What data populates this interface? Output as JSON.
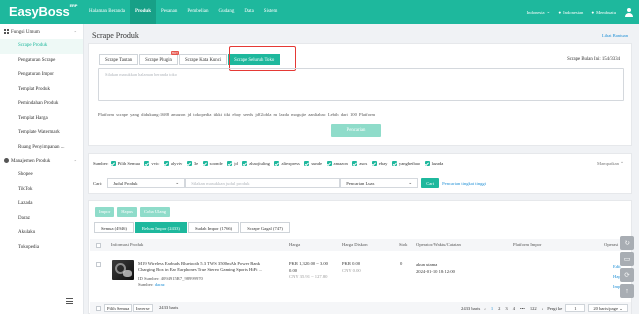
{
  "header": {
    "logo": "EasyBoss",
    "logo_sup": "ERP",
    "nav": [
      "Halaman Beranda",
      "Produk",
      "Pesanan",
      "Pembelian",
      "Gudang",
      "Data",
      "Sistem"
    ],
    "active_nav": "Produk",
    "region": "Indonesia",
    "lang": "Indonesian",
    "member": "Membuatu"
  },
  "sidebar": {
    "group1": "Fungsi Umum",
    "items1": [
      "Scrape Produk",
      "Pengaturan Scrape",
      "Pengaturan Impor",
      "Templat Produk",
      "Pemindahan Produk",
      "Templat Harga",
      "Template Watermark",
      "Ruang Penyimpanan ..."
    ],
    "active_item": "Scrape Produk",
    "group2": "Manajemen Produk",
    "items2": [
      "Shopee",
      "TikTok",
      "Lazada",
      "Daraz",
      "Akulaku",
      "Tokopedia"
    ]
  },
  "page": {
    "title": "Scrape Produk",
    "help": "Lihat Bantuan"
  },
  "scrape": {
    "tabs": [
      "Scrape Tautan",
      "Scrape Plugin",
      "Scrape Kata Kunci",
      "Scrape Seluruh Toko"
    ],
    "hot_badge": "HOT",
    "quota_label": "Scrape Bulan Ini:",
    "quota_value": "154/3334",
    "placeholder": "Silakan masukkan halaman beranda toko",
    "platforms_text": "Platform scrape yang didukung:1688   amazon   jd   tokopedia   tikki   tiki   ebay   seeds   jdGlobla   m   lazda   mogujie   aanliabac",
    "platforms_more": "Lebih dari 100 Platform",
    "collect_btn": "Pencarian"
  },
  "filters": {
    "source_label": "Sumber:",
    "sources": [
      "Pilih Semua",
      "vvic",
      "alyviv",
      "3e",
      "soonde",
      "jd",
      "zhaojiuling",
      "aliexpress",
      "sunde",
      "amazon",
      "asos",
      "ebay",
      "yangbeibao",
      "lazada"
    ],
    "collapse": "Mampatkan",
    "search_label": "Cari:",
    "field_select": "Judul Produk",
    "search_placeholder": "Silakan masukkan judul produk",
    "match_select": "Pencarian Luas",
    "search_btn": "Cari",
    "advanced": "Pencarian tingkat tinggi"
  },
  "list": {
    "actions": [
      "Impor",
      "Hapus",
      "Coba Ulang"
    ],
    "status_tabs": [
      "Semua (4946)",
      "Belum Impor (2433)",
      "Sudah Impor (1766)",
      "Scrape Gagal (747)"
    ],
    "active_status": "Belum Impor (2433)",
    "columns": [
      "Informasi Produk",
      "Harga",
      "Harga Diskon",
      "Stok",
      "Operator/Waktu/Catatan",
      "Platform Impor",
      "Operasi"
    ],
    "rows": [
      {
        "title": "M19 Wireless Earbuds Bluetooth 5.3 TWS 3500mAh Power Bank Charging Box in Ear Earphones True Stereo Gaming Sports HiFi ...",
        "id_label": "ID Sumber:",
        "id": "4094915R7_98999970",
        "source_label": "Sumber:",
        "source": "daraz",
        "price_main": "PKR 1,320.00 ~ 3.00",
        "price_2": "0.00",
        "price_cny": "CNY 35.91 ~ 127.80",
        "disc_main": "PKR 0.00",
        "disc_cny": "CNY 0.00",
        "stock": "0",
        "operator": "akun utama",
        "time": "2024-01-10 18:12:00",
        "ops": [
          "Edit",
          "Hapus",
          "Impor"
        ]
      }
    ],
    "footer": {
      "select_all": "Pilih Semua",
      "invert": "Inverse",
      "count": "2433 baris",
      "total": "2433 baris",
      "pages": [
        "1",
        "2",
        "3",
        "4",
        "•••",
        "122"
      ],
      "current_page": "1",
      "goto_label": "Pergi ke",
      "goto_value": "1",
      "page_size": "20 baris/page"
    }
  }
}
